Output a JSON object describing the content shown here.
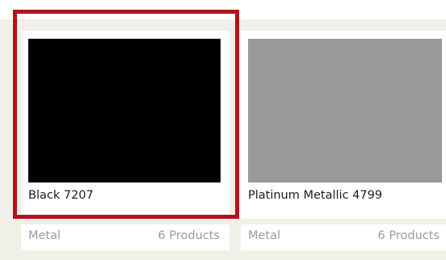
{
  "products": [
    {
      "name": "Black 7207",
      "category": "Metal",
      "count": "6 Products",
      "color": "#000000",
      "selected": true
    },
    {
      "name": "Platinum Metallic 4799",
      "category": "Metal",
      "count": "6 Products",
      "color": "#999a98",
      "selected": false
    }
  ],
  "colors": {
    "highlight": "#b5121b",
    "background_band": "#f1f0e8"
  }
}
